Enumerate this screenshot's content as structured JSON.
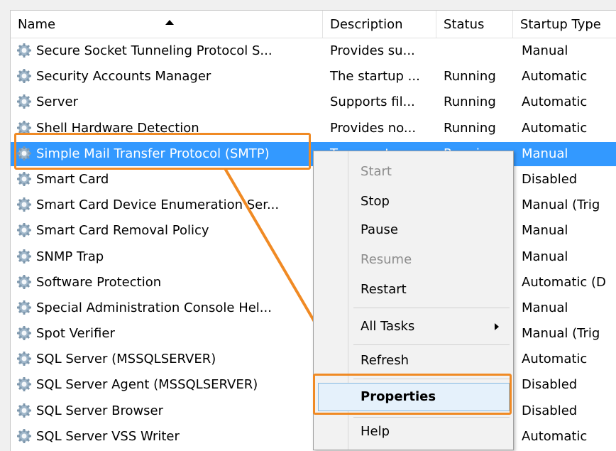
{
  "columns": {
    "name": "Name",
    "description": "Description",
    "status": "Status",
    "startup_type": "Startup Type"
  },
  "services": [
    {
      "name": "Secure Socket Tunneling Protocol S...",
      "description": "Provides su...",
      "status": "",
      "startup_type": "Manual"
    },
    {
      "name": "Security Accounts Manager",
      "description": "The startup ...",
      "status": "Running",
      "startup_type": "Automatic"
    },
    {
      "name": "Server",
      "description": "Supports fil...",
      "status": "Running",
      "startup_type": "Automatic"
    },
    {
      "name": "Shell Hardware Detection",
      "description": "Provides no...",
      "status": "Running",
      "startup_type": "Automatic"
    },
    {
      "name": "Simple Mail Transfer Protocol (SMTP)",
      "description": "Transports...",
      "status": "Running",
      "startup_type": "Manual",
      "selected": true
    },
    {
      "name": "Smart Card",
      "description": "",
      "status": "",
      "startup_type": "Disabled"
    },
    {
      "name": "Smart Card Device Enumeration Ser...",
      "description": "",
      "status": "",
      "startup_type": "Manual (Trig"
    },
    {
      "name": "Smart Card Removal Policy",
      "description": "",
      "status": "",
      "startup_type": "Manual"
    },
    {
      "name": "SNMP Trap",
      "description": "",
      "status": "",
      "startup_type": "Manual"
    },
    {
      "name": "Software Protection",
      "description": "",
      "status": "",
      "startup_type": "Automatic (D"
    },
    {
      "name": "Special Administration Console Hel...",
      "description": "",
      "status": "",
      "startup_type": "Manual"
    },
    {
      "name": "Spot Verifier",
      "description": "",
      "status": "",
      "startup_type": "Manual (Trig"
    },
    {
      "name": "SQL Server (MSSQLSERVER)",
      "description": "",
      "status": "",
      "startup_type": "Automatic"
    },
    {
      "name": "SQL Server Agent (MSSQLSERVER)",
      "description": "",
      "status": "",
      "startup_type": "Disabled"
    },
    {
      "name": "SQL Server Browser",
      "description": "",
      "status": "",
      "startup_type": "Disabled"
    },
    {
      "name": "SQL Server VSS Writer",
      "description": "",
      "status": "",
      "startup_type": "Automatic"
    }
  ],
  "context_menu": {
    "start": "Start",
    "stop": "Stop",
    "pause": "Pause",
    "resume": "Resume",
    "restart": "Restart",
    "all_tasks": "All Tasks",
    "refresh": "Refresh",
    "properties": "Properties",
    "help": "Help"
  },
  "colors": {
    "selection": "#3399ff",
    "callout": "#f08a24",
    "menu_background": "#f2f2f2",
    "properties_highlight": "#e5f1fb"
  },
  "icons": {
    "service": "gear-icon",
    "sort": "sort-ascending-icon",
    "submenu": "submenu-arrow-icon"
  }
}
